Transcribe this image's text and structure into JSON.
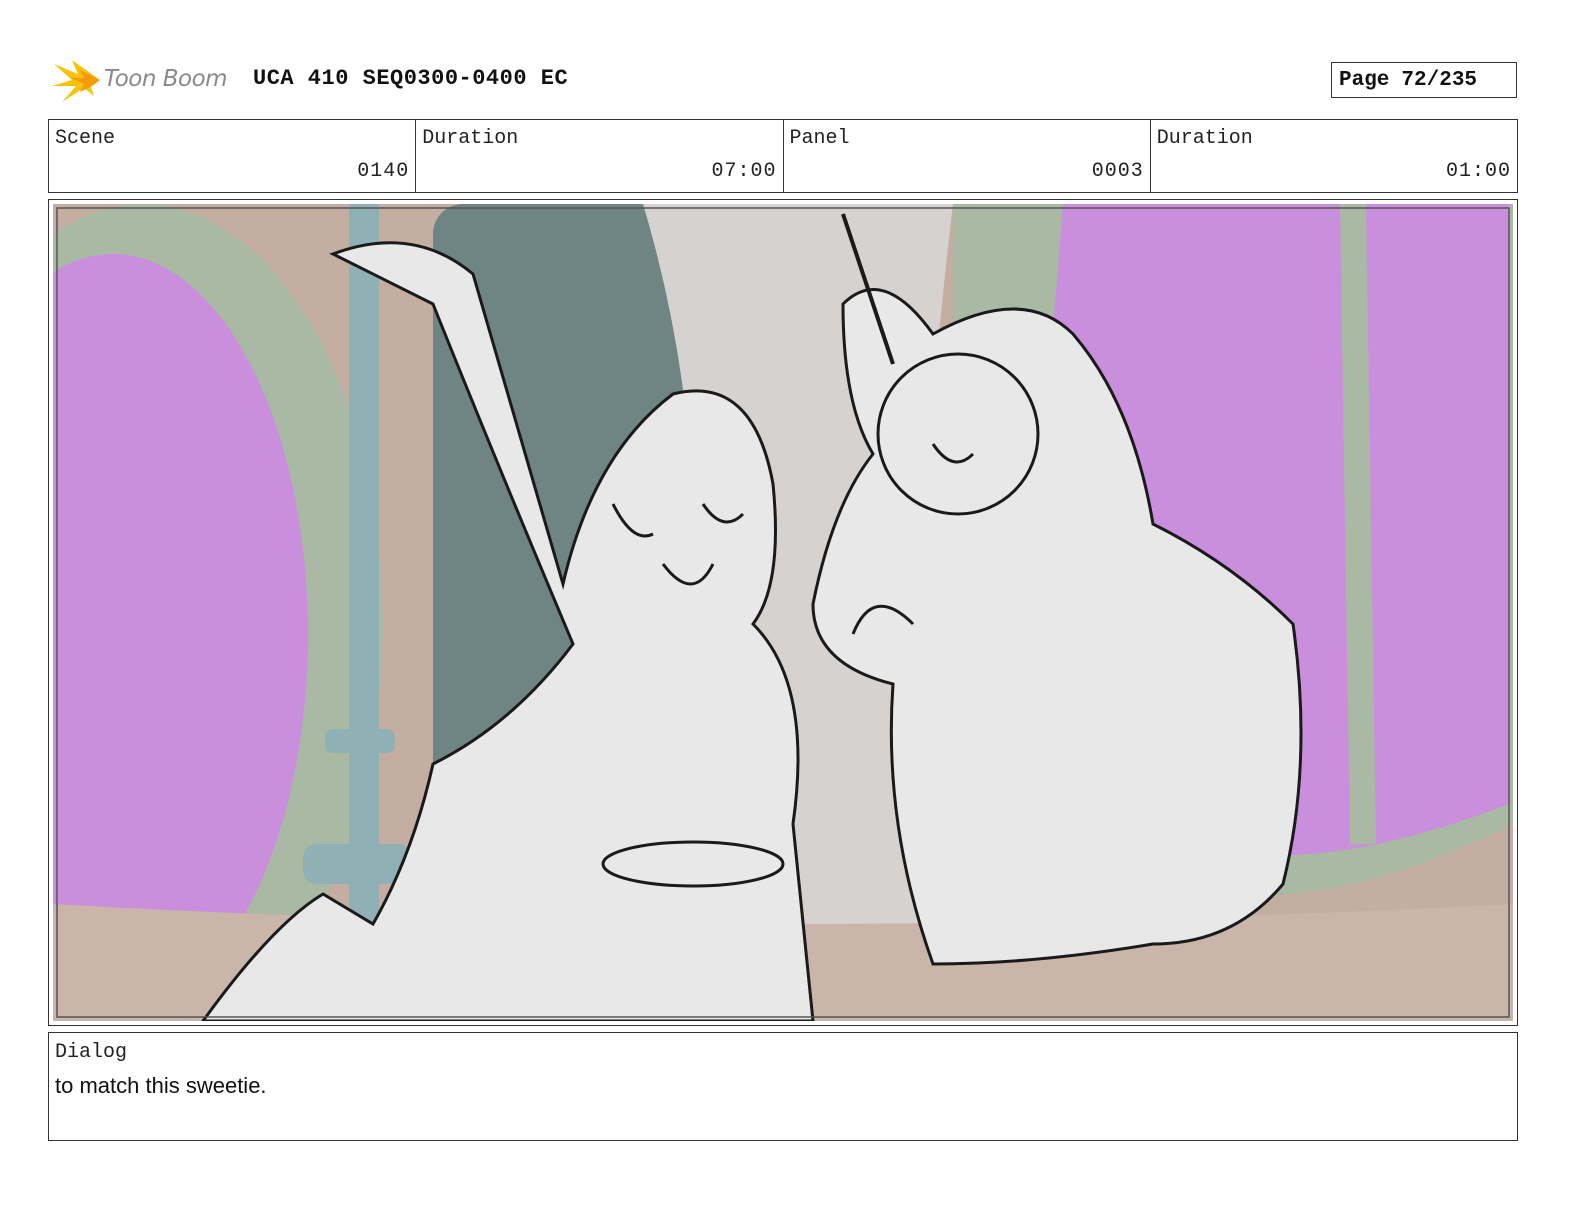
{
  "header": {
    "logo_text": "Toon Boom",
    "project_title": "UCA 410 SEQ0300-0400 EC",
    "page_label": "Page",
    "page_value": "72/235"
  },
  "info": {
    "scene_label": "Scene",
    "scene_value": "0140",
    "scene_duration_label": "Duration",
    "scene_duration_value": "07:00",
    "panel_label": "Panel",
    "panel_value": "0003",
    "panel_duration_label": "Duration",
    "panel_duration_value": "01:00"
  },
  "dialog": {
    "label": "Dialog",
    "text": "to match this sweetie."
  },
  "colors": {
    "window_purple": "#c98fdc",
    "frame_green": "#a9b9a4",
    "wall_tan": "#c4aea2",
    "pole_teal": "#8fb0b4",
    "sketch_fill": "#e8e8e8",
    "logo_yellow": "#f7c20c"
  }
}
